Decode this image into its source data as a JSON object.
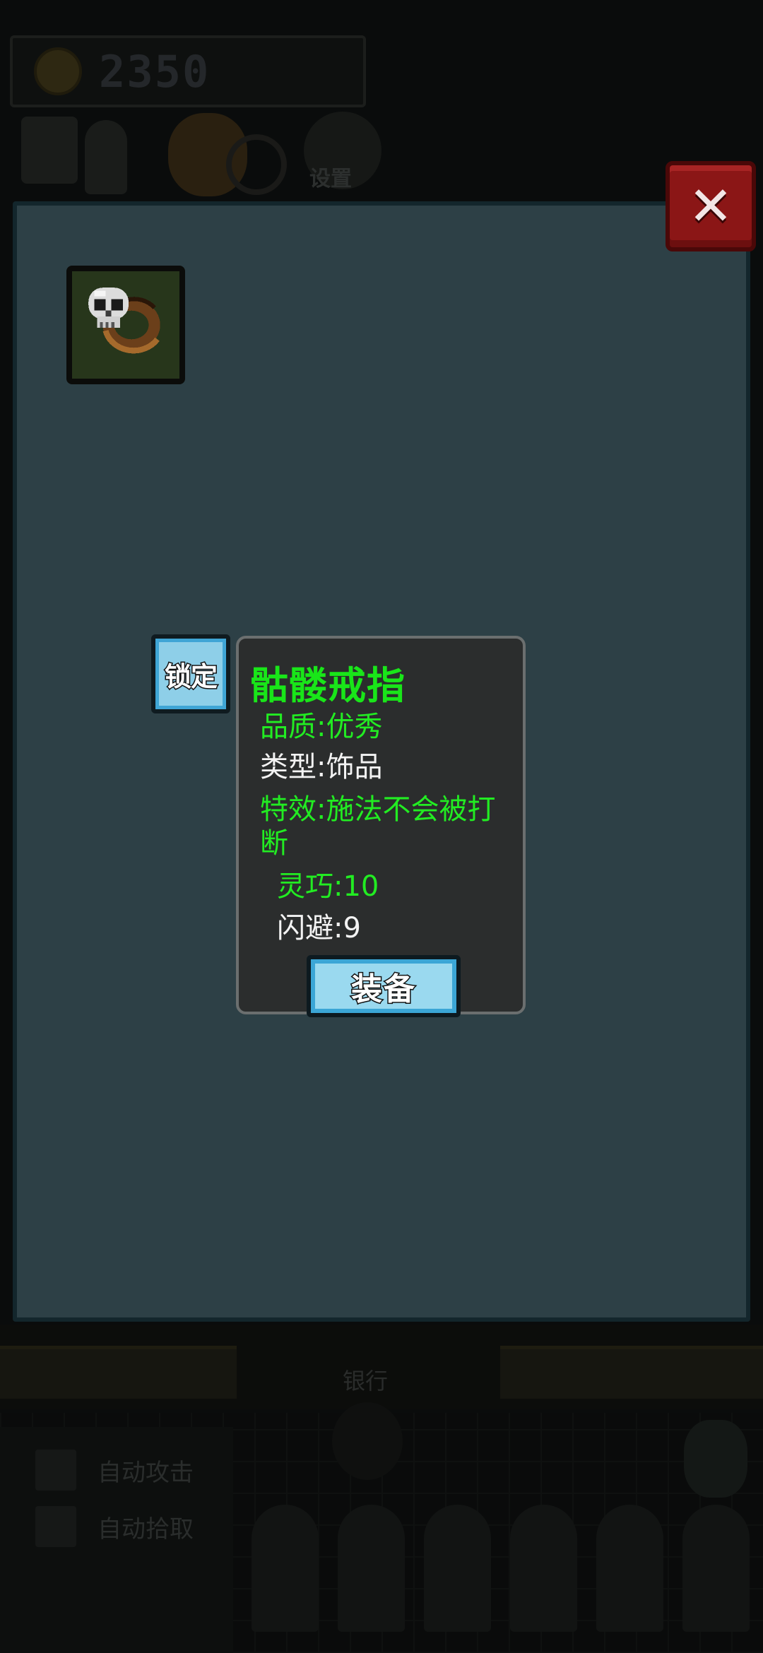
{
  "hud": {
    "coins": "2350",
    "settings_label": "设置"
  },
  "panel": {
    "close_label": "✕"
  },
  "inventory": {
    "slots": [
      {
        "icon": "skull-ring-icon"
      }
    ]
  },
  "tooltip": {
    "lock_label": "锁定",
    "item_name": "骷髅戒指",
    "quality": "品质:优秀",
    "type": "类型:饰品",
    "effect": "特效:施法不会被打断",
    "stats": [
      "灵巧:10",
      "闪避:9"
    ],
    "equip_label": "装备"
  },
  "background": {
    "bank_label": "银行",
    "auto_attack_label": "自动攻击",
    "auto_pickup_label": "自动拾取"
  },
  "colors": {
    "panel_bg": "#2d4046",
    "tooltip_bg": "#2b2d2d",
    "highlight_green": "#22ec22",
    "close_red": "#8b1616",
    "button_blue": "#9ad9ef"
  }
}
